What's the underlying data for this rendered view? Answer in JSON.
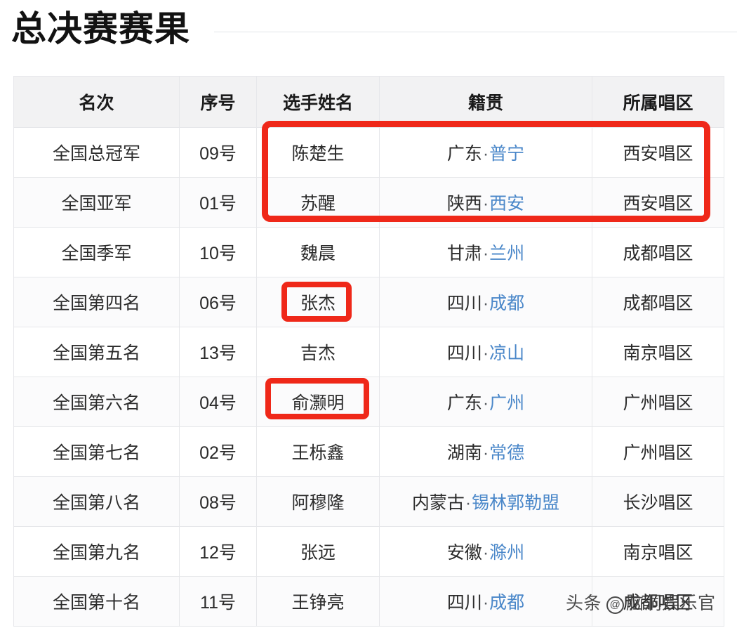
{
  "page": {
    "title": "总决赛赛果"
  },
  "table": {
    "headers": [
      "名次",
      "序号",
      "选手姓名",
      "籍贯",
      "所属唱区"
    ],
    "rows": [
      {
        "rank": "全国总冠军",
        "number": "09号",
        "name": "陈楚生",
        "home_province": "广东",
        "home_sep": "·",
        "home_city": "普宁",
        "area": "西安唱区"
      },
      {
        "rank": "全国亚军",
        "number": "01号",
        "name": "苏醒",
        "home_province": "陕西",
        "home_sep": "·",
        "home_city": "西安",
        "area": "西安唱区"
      },
      {
        "rank": "全国季军",
        "number": "10号",
        "name": "魏晨",
        "home_province": "甘肃",
        "home_sep": "·",
        "home_city": "兰州",
        "area": "成都唱区"
      },
      {
        "rank": "全国第四名",
        "number": "06号",
        "name": "张杰",
        "home_province": "四川",
        "home_sep": "·",
        "home_city": "成都",
        "area": "成都唱区"
      },
      {
        "rank": "全国第五名",
        "number": "13号",
        "name": "吉杰",
        "home_province": "四川",
        "home_sep": "·",
        "home_city": "凉山",
        "area": "南京唱区"
      },
      {
        "rank": "全国第六名",
        "number": "04号",
        "name": "俞灏明",
        "home_province": "广东",
        "home_sep": "·",
        "home_city": "广州",
        "area": "广州唱区"
      },
      {
        "rank": "全国第七名",
        "number": "02号",
        "name": "王栎鑫",
        "home_province": "湖南",
        "home_sep": "·",
        "home_city": "常德",
        "area": "广州唱区"
      },
      {
        "rank": "全国第八名",
        "number": "08号",
        "name": "阿穆隆",
        "home_province": "内蒙古",
        "home_sep": "·",
        "home_city": "锡林郭勒盟",
        "area": "长沙唱区"
      },
      {
        "rank": "全国第九名",
        "number": "12号",
        "name": "张远",
        "home_province": "安徽",
        "home_sep": "·",
        "home_city": "滁州",
        "area": "南京唱区"
      },
      {
        "rank": "全国第十名",
        "number": "11号",
        "name": "王铮亮",
        "home_province": "四川",
        "home_sep": "·",
        "home_city": "成都",
        "area": "成都唱区"
      }
    ]
  },
  "annotations": {
    "highlight_boxes": [
      {
        "label": "top-two-rows-highlight",
        "rows": [
          "全国总冠军",
          "全国亚军"
        ],
        "columns": [
          "选手姓名",
          "籍贯",
          "所属唱区"
        ],
        "color": "#ef2819"
      },
      {
        "label": "zhangjie-name-highlight",
        "rows": [
          "全国第四名"
        ],
        "columns": [
          "选手姓名"
        ],
        "color": "#ef2819"
      },
      {
        "label": "yuhaoming-name-highlight",
        "rows": [
          "全国第六名"
        ],
        "columns": [
          "选手姓名"
        ],
        "color": "#ef2819"
      }
    ]
  },
  "watermark": {
    "source": "头条",
    "at": "@",
    "account": "脑洞娱乐官"
  },
  "colors": {
    "link_blue": "#3b6fb0",
    "city_blue": "#4a87c9",
    "highlight_red": "#ef2819",
    "header_bg": "#f2f2f3",
    "border": "#e6e7ea",
    "text": "#2b2b2b"
  }
}
